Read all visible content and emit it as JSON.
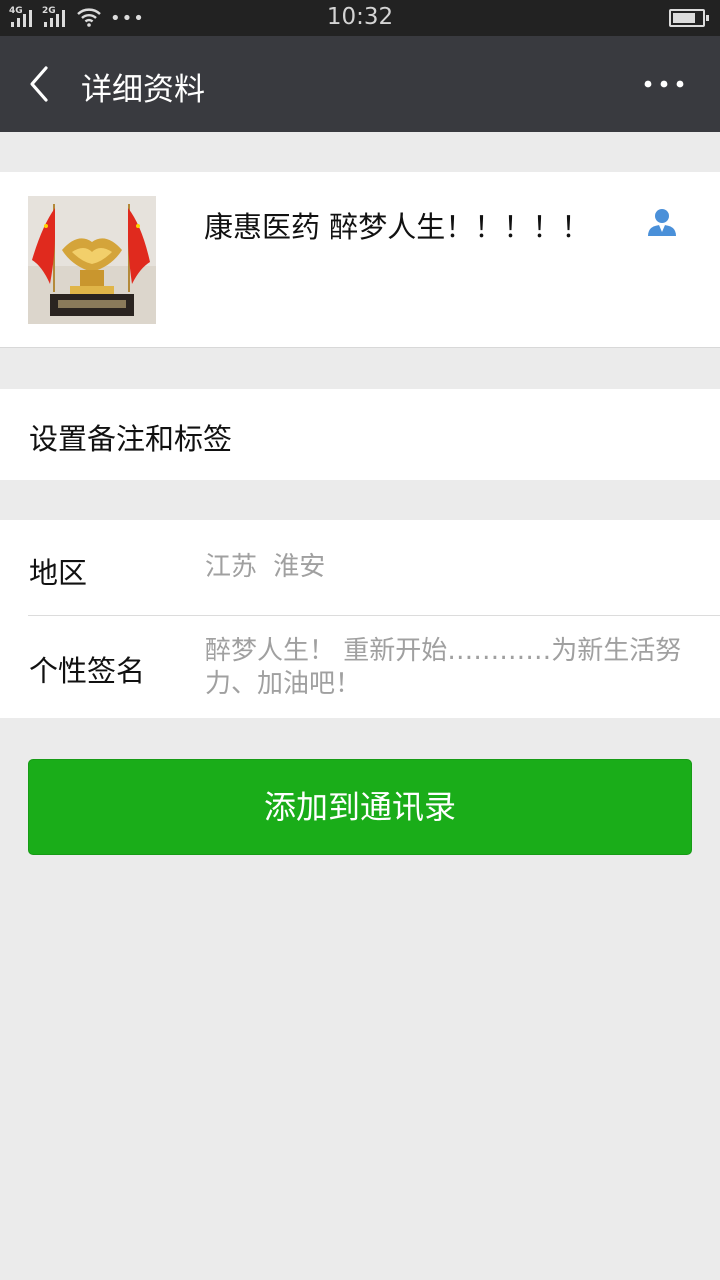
{
  "status_bar": {
    "network_1": "4G",
    "network_2": "2G",
    "more_indicator": "•••",
    "time": "10:32"
  },
  "nav": {
    "title": "详细资料",
    "back_icon": "chevron-left-icon",
    "more_icon": "more-dots-icon"
  },
  "profile": {
    "name": "康惠医药 醉梦人生！！！！！",
    "avatar": "handshake-trophy-with-flags",
    "contact_icon": "contact-person-icon"
  },
  "remark": {
    "label": "设置备注和标签"
  },
  "info": {
    "region_label": "地区",
    "region_value": "江苏  淮安",
    "signature_label": "个性签名",
    "signature_value": "醉梦人生！ 重新开始…………为新生活努力、加油吧！"
  },
  "actions": {
    "add_contact": "添加到通讯录"
  },
  "colors": {
    "status_bar": "#222222",
    "nav_bar": "#393a3f",
    "background": "#ebebeb",
    "primary_button": "#1aad19",
    "contact_icon": "#4a90d9"
  }
}
